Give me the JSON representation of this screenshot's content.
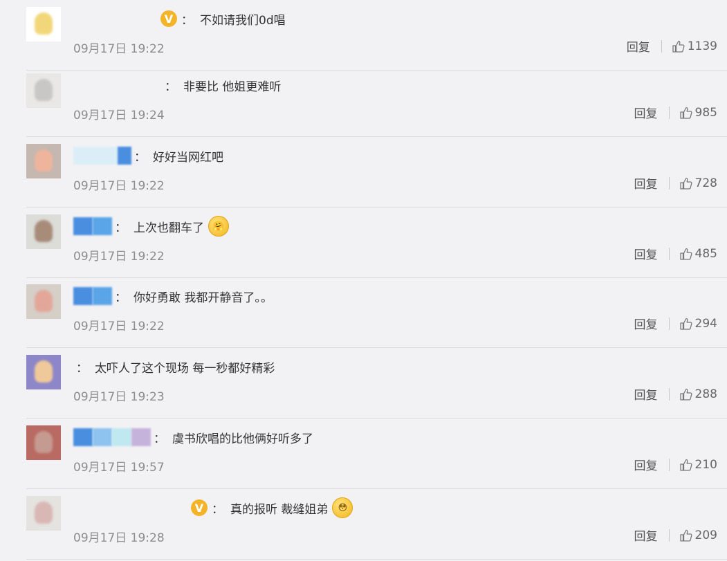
{
  "comments": [
    {
      "badge": "V",
      "colon": "：",
      "text": "不如请我们0d唱",
      "time": "09月17日 19:22",
      "reply": "回复",
      "likes": "1139",
      "name_blocks": [],
      "emoji": "",
      "avatar_bg": "#ffffff",
      "avatar_face": "#f2d77a"
    },
    {
      "badge": "",
      "colon": "：",
      "text": "非要比 他姐更难听",
      "time": "09月17日 19:24",
      "reply": "回复",
      "likes": "985",
      "name_blocks": [],
      "emoji": "",
      "avatar_bg": "#e9e8e6",
      "avatar_face": "#c9c7c4"
    },
    {
      "badge": "",
      "colon": "：",
      "text": "好好当网红吧",
      "time": "09月17日 19:22",
      "reply": "回复",
      "likes": "728",
      "name_blocks": [
        "#dbeef7",
        "#4a8ee0"
      ],
      "emoji": "",
      "avatar_bg": "#c4b8b0",
      "avatar_face": "#efb49c"
    },
    {
      "badge": "",
      "colon": "：",
      "text": "上次也翻车了",
      "time": "09月17日 19:22",
      "reply": "回复",
      "likes": "485",
      "name_blocks": [
        "#4a8ee0",
        "#5aa5e8"
      ],
      "emoji": "🤗",
      "avatar_bg": "#dcdcd8",
      "avatar_face": "#a88c7a"
    },
    {
      "badge": "",
      "colon": "：",
      "text": "你好勇敢 我都开静音了。。",
      "time": "09月17日 19:22",
      "reply": "回复",
      "likes": "294",
      "name_blocks": [
        "#4a8ee0",
        "#5aa5e8"
      ],
      "emoji": "",
      "avatar_bg": "#d6cfc8",
      "avatar_face": "#e3a79a"
    },
    {
      "badge": "",
      "colon": "：",
      "text": "太吓人了这个现场 每一秒都好精彩",
      "time": "09月17日 19:23",
      "reply": "回复",
      "likes": "288",
      "name_blocks": [],
      "emoji": "",
      "avatar_bg": "#8d86c8",
      "avatar_face": "#f0c99a"
    },
    {
      "badge": "",
      "colon": "：",
      "text": "虞书欣唱的比他俩好听多了",
      "time": "09月17日 19:57",
      "reply": "回复",
      "likes": "210",
      "name_blocks": [
        "#4a8ee0",
        "#8fc3ef",
        "#bfe8f0",
        "#c6b3dc"
      ],
      "emoji": "",
      "avatar_bg": "#b96a62",
      "avatar_face": "#c59a90"
    },
    {
      "badge": "V",
      "colon": "：",
      "text": "真的报听 裁缝姐弟",
      "time": "09月17日 19:28",
      "reply": "回复",
      "likes": "209",
      "name_blocks": [],
      "emoji": "😳",
      "avatar_bg": "#e5e3e0",
      "avatar_face": "#d9b7b4"
    }
  ],
  "icons": {
    "like": "thumbs-up-icon",
    "badge": "verified-v-icon"
  }
}
